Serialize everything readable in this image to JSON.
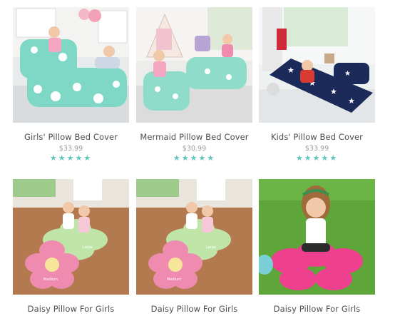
{
  "products": [
    {
      "name": "Girls' Pillow Bed Cover",
      "price": "$33.99",
      "rating_stars": 5
    },
    {
      "name": "Mermaid Pillow Bed Cover",
      "price": "$30.99",
      "rating_stars": 5
    },
    {
      "name": "Kids' Pillow Bed Cover",
      "price": "$33.99",
      "rating_stars": 5
    },
    {
      "name": "Daisy Pillow For Girls",
      "photo_labels": [
        "Medium",
        "Large"
      ]
    },
    {
      "name": "Daisy Pillow For Girls",
      "photo_labels": [
        "Medium",
        "Large"
      ]
    },
    {
      "name": "Daisy Pillow For Girls"
    }
  ],
  "colors": {
    "star": "#5fc6be",
    "mint": "#7fd8c6",
    "navy": "#1c2a5a",
    "pink": "#f08bb0",
    "hot_pink": "#ef3f8f",
    "green": "#bfe6a8",
    "grass": "#5fa63a"
  },
  "star_glyph": "★"
}
